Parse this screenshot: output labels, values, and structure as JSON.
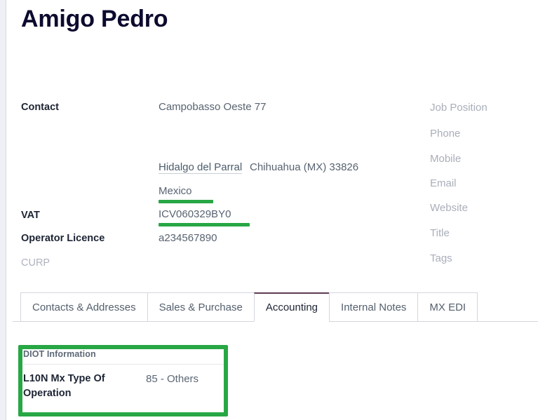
{
  "record": {
    "title": "Amigo Pedro"
  },
  "contact": {
    "label": "Contact",
    "street": "Campobasso Oeste  77",
    "city": "Hidalgo del Parral",
    "state_country": "Chihuahua (MX)  33826",
    "country": "Mexico"
  },
  "fields": {
    "vat_label": "VAT",
    "vat_value": "ICV060329BY0",
    "operator_licence_label": "Operator Licence",
    "operator_licence_value": "a234567890",
    "curp_label": "CURP"
  },
  "right_placeholders": [
    {
      "label": "Job Position"
    },
    {
      "label": "Phone"
    },
    {
      "label": "Mobile"
    },
    {
      "label": "Email"
    },
    {
      "label": "Website"
    },
    {
      "label": "Title"
    },
    {
      "label": "Tags"
    }
  ],
  "tabs": [
    {
      "label": "Contacts & Addresses",
      "active": false
    },
    {
      "label": "Sales & Purchase",
      "active": false
    },
    {
      "label": "Accounting",
      "active": true
    },
    {
      "label": "Internal Notes",
      "active": false
    },
    {
      "label": "MX EDI",
      "active": false
    }
  ],
  "accounting": {
    "diot": {
      "section_title": "DIOT Information",
      "type_of_operation_label": "L10N Mx Type Of Operation",
      "type_of_operation_value": "85 - Others"
    }
  },
  "annotations": {
    "highlight_color": "#28a745",
    "underline_country": "Mexico",
    "underline_vat": "ICV060329BY0",
    "box_target": "DIOT Information"
  },
  "colors": {
    "accent_tab": "#5d3b54",
    "title": "#0c0a2e",
    "label": "#1d2433",
    "value": "#586371",
    "placeholder": "#a9aeb9",
    "highlight_green": "#28a745"
  }
}
